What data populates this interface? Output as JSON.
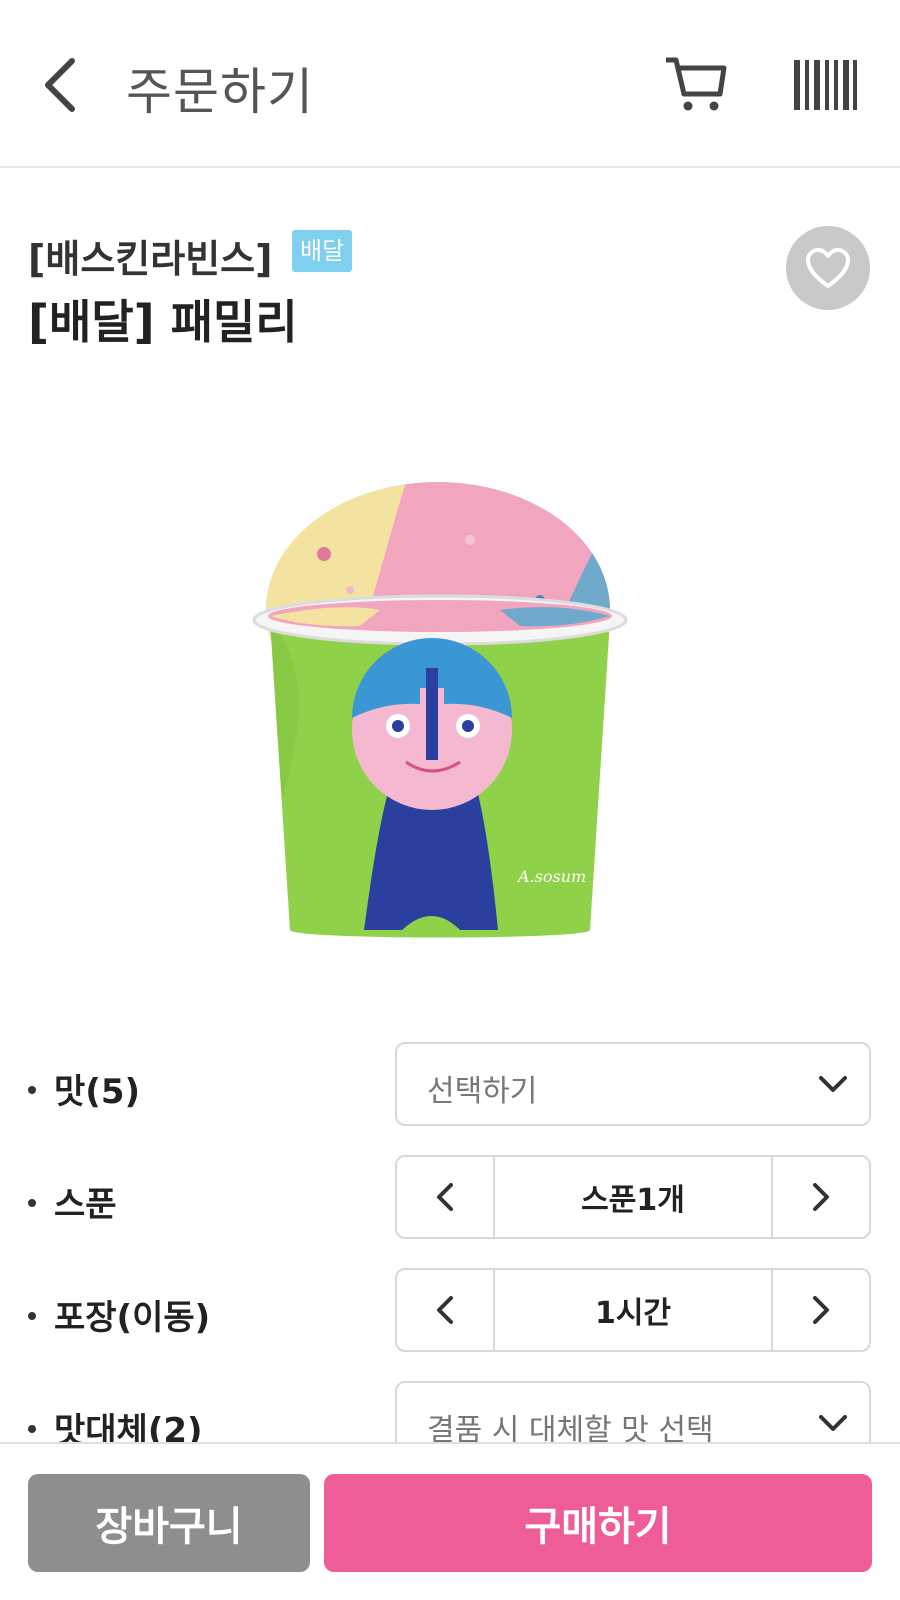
{
  "header": {
    "title": "주문하기",
    "back_icon": "chevron-left-icon",
    "cart_icon": "cart-icon",
    "barcode_icon": "barcode-icon"
  },
  "product": {
    "brand": "[배스킨라빈스]",
    "badge": "배달",
    "name": "[배달] 패밀리",
    "favorite_icon": "heart-icon",
    "image": "ice-cream-family-cup",
    "signature": "A.sosum"
  },
  "options": {
    "flavor": {
      "label": "맛(5)",
      "placeholder": "선택하기"
    },
    "spoon": {
      "label": "스푼",
      "value": "스푼1개"
    },
    "packaging": {
      "label": "포장(이동)",
      "value": "1시간"
    },
    "substitute": {
      "label": "맛대체(2)",
      "placeholder": "결품 시 대체할 맛 선택"
    }
  },
  "actions": {
    "cart_label": "장바구니",
    "buy_label": "구매하기"
  },
  "colors": {
    "badge": "#7fcfee",
    "buy": "#ee5d97",
    "cart": "#8e8e8e",
    "cup": "#8fd24a"
  }
}
